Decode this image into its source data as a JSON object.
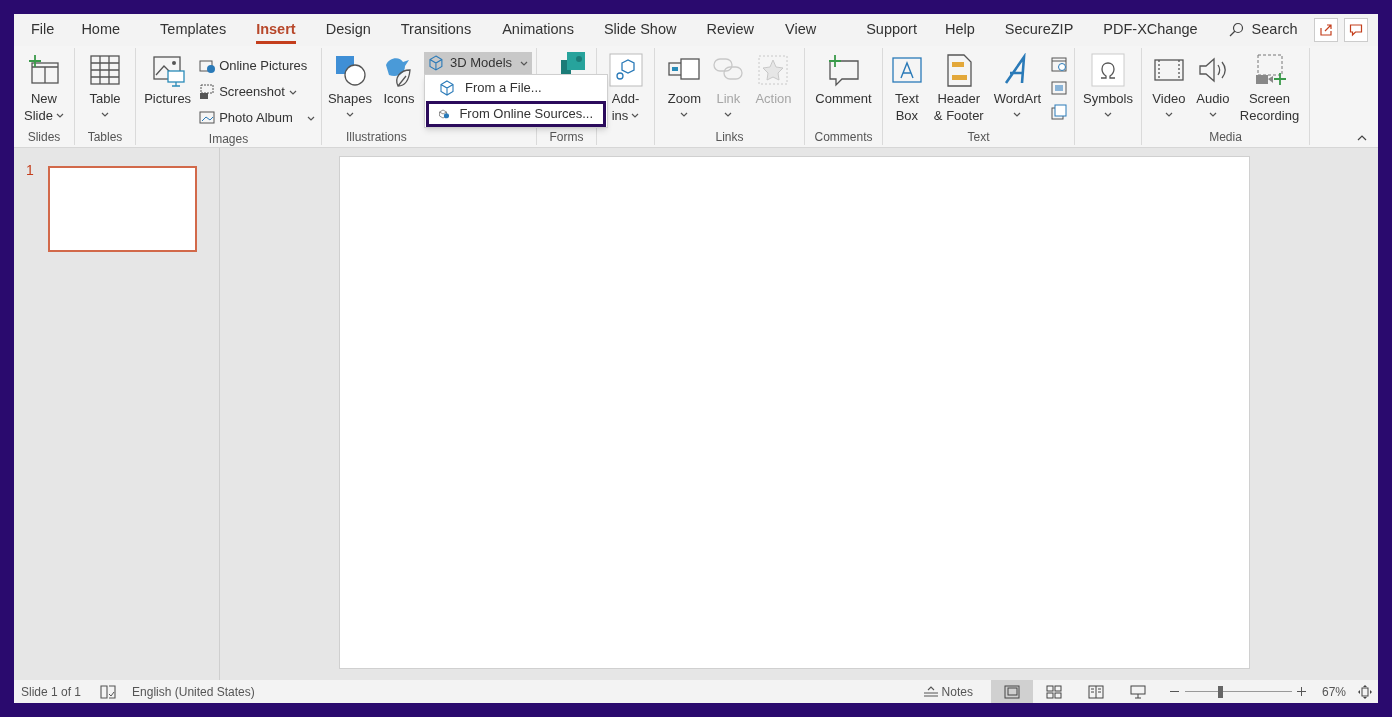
{
  "menu_tabs": [
    {
      "label": "File",
      "selected": false
    },
    {
      "label": "Home",
      "selected": false
    },
    {
      "label": "Templates",
      "selected": false
    },
    {
      "label": "Insert",
      "selected": true
    },
    {
      "label": "Design",
      "selected": false
    },
    {
      "label": "Transitions",
      "selected": false
    },
    {
      "label": "Animations",
      "selected": false
    },
    {
      "label": "Slide Show",
      "selected": false
    },
    {
      "label": "Review",
      "selected": false
    },
    {
      "label": "View",
      "selected": false
    },
    {
      "label": "Support",
      "selected": false
    },
    {
      "label": "Help",
      "selected": false
    },
    {
      "label": "SecureZIP",
      "selected": false
    },
    {
      "label": "PDF-XChange",
      "selected": false
    }
  ],
  "search": {
    "label": "Search"
  },
  "ribbon_groups": [
    {
      "label": "Slides",
      "items": [
        {
          "kind": "large",
          "lines": [
            "New",
            "Slide"
          ],
          "dropdown": true,
          "disabled": false
        }
      ]
    },
    {
      "label": "Tables",
      "items": [
        {
          "kind": "large",
          "lines": [
            "Table"
          ],
          "dropdown": true,
          "disabled": false
        }
      ]
    },
    {
      "label": "Images",
      "items": [
        {
          "kind": "large",
          "lines": [
            "Pictures"
          ],
          "dropdown": false,
          "disabled": false
        },
        {
          "kind": "small_column",
          "rows": [
            {
              "label": "Online Pictures",
              "dropdown": false
            },
            {
              "label": "Screenshot",
              "dropdown": true
            },
            {
              "label": "Photo Album",
              "dropdown": true
            }
          ]
        }
      ]
    },
    {
      "label": "Illustrations",
      "items": [
        {
          "kind": "large",
          "lines": [
            "Shapes"
          ],
          "dropdown": true,
          "disabled": false
        },
        {
          "kind": "large",
          "lines": [
            "Icons"
          ],
          "dropdown": false,
          "disabled": false
        },
        {
          "kind": "menu_button",
          "label": "3D Models",
          "dropdown": true,
          "expanded": true,
          "menu": [
            {
              "label": "From a File...",
              "highlighted": false
            },
            {
              "label": "From Online Sources...",
              "highlighted": true
            }
          ]
        }
      ]
    },
    {
      "label": "Forms",
      "items": [
        {
          "kind": "large",
          "dropdown": false,
          "disabled": false
        }
      ]
    },
    {
      "items": [
        {
          "kind": "large",
          "lines": [
            "Add-",
            "ins"
          ],
          "dropdown": true,
          "disabled": false
        }
      ]
    },
    {
      "label": "Links",
      "items": [
        {
          "kind": "large",
          "lines": [
            "Zoom"
          ],
          "dropdown": true,
          "disabled": false
        },
        {
          "kind": "large",
          "lines": [
            "Link"
          ],
          "dropdown": true,
          "disabled": true
        },
        {
          "kind": "large",
          "lines": [
            "Action"
          ],
          "dropdown": false,
          "disabled": true
        }
      ]
    },
    {
      "label": "Comments",
      "items": [
        {
          "kind": "large",
          "lines": [
            "Comment"
          ],
          "dropdown": false,
          "disabled": false
        }
      ]
    },
    {
      "label": "Text",
      "items": [
        {
          "kind": "large",
          "lines": [
            "Text",
            "Box"
          ],
          "dropdown": false,
          "disabled": false
        },
        {
          "kind": "large",
          "lines": [
            "Header",
            "& Footer"
          ],
          "dropdown": false,
          "disabled": false
        },
        {
          "kind": "large",
          "lines": [
            "WordArt"
          ],
          "dropdown": true,
          "disabled": false
        },
        {
          "kind": "icon_column"
        }
      ]
    },
    {
      "items": [
        {
          "kind": "large",
          "lines": [
            "Symbols"
          ],
          "dropdown": true,
          "disabled": false
        }
      ]
    },
    {
      "label": "Media",
      "items": [
        {
          "kind": "large",
          "lines": [
            "Video"
          ],
          "dropdown": true,
          "disabled": false
        },
        {
          "kind": "large",
          "lines": [
            "Audio"
          ],
          "dropdown": true,
          "disabled": false
        },
        {
          "kind": "large",
          "lines": [
            "Screen",
            "Recording"
          ],
          "dropdown": false,
          "disabled": false
        }
      ]
    }
  ],
  "slides_pane": [
    {
      "number": "1",
      "selected": true
    }
  ],
  "status_bar": {
    "slide_info": "Slide 1 of 1",
    "language": "English (United States)",
    "notes": "Notes",
    "views": [
      {
        "selected": true
      },
      {
        "selected": false
      },
      {
        "selected": false
      },
      {
        "selected": false
      }
    ],
    "zoom": {
      "level": 0.33,
      "reading": "67%"
    }
  }
}
